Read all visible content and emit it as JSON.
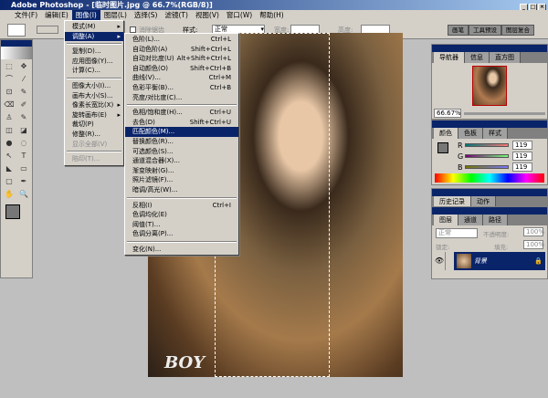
{
  "window": {
    "title": "Adobe Photoshop - [临时图片.jpg @ 66.7%(RGB/8)]"
  },
  "menubar": [
    "文件(F)",
    "编辑(E)",
    "图像(I)",
    "图层(L)",
    "选择(S)",
    "滤镜(T)",
    "视图(V)",
    "窗口(W)",
    "帮助(H)"
  ],
  "options": {
    "antialias_label": "消除锯齿",
    "style_label": "样式:",
    "style_value": "正常",
    "width_label": "宽度:",
    "height_label": "高度:"
  },
  "palette_well": [
    "画笔",
    "工具预设",
    "图层复合"
  ],
  "image_menu": [
    {
      "label": "模式(M)",
      "sub": true
    },
    {
      "label": "调整(A)",
      "sub": true,
      "hl": true
    },
    "-",
    {
      "label": "复制(D)..."
    },
    {
      "label": "应用图像(Y)..."
    },
    {
      "label": "计算(C)..."
    },
    "-",
    {
      "label": "图像大小(I)..."
    },
    {
      "label": "画布大小(S)..."
    },
    {
      "label": "像素长宽比(X)",
      "sub": true
    },
    {
      "label": "旋转画布(E)",
      "sub": true
    },
    {
      "label": "裁切(P)"
    },
    {
      "label": "修整(R)..."
    },
    {
      "label": "显示全部(V)",
      "dis": true
    },
    "-",
    {
      "label": "陷印(T)...",
      "dis": true
    }
  ],
  "adjust_menu": [
    {
      "label": "色阶(L)...",
      "sc": "Ctrl+L"
    },
    {
      "label": "自动色阶(A)",
      "sc": "Shift+Ctrl+L"
    },
    {
      "label": "自动对比度(U)",
      "sc": "Alt+Shift+Ctrl+L"
    },
    {
      "label": "自动颜色(O)",
      "sc": "Shift+Ctrl+B"
    },
    {
      "label": "曲线(V)...",
      "sc": "Ctrl+M"
    },
    {
      "label": "色彩平衡(B)...",
      "sc": "Ctrl+B"
    },
    {
      "label": "亮度/对比度(C)..."
    },
    "-",
    {
      "label": "色相/饱和度(H)...",
      "sc": "Ctrl+U"
    },
    {
      "label": "去色(D)",
      "sc": "Shift+Ctrl+U"
    },
    {
      "label": "匹配颜色(M)...",
      "hl": true
    },
    {
      "label": "替换颜色(R)..."
    },
    {
      "label": "可选颜色(S)..."
    },
    {
      "label": "通道混合器(X)..."
    },
    {
      "label": "渐变映射(G)..."
    },
    {
      "label": "照片滤镜(F)..."
    },
    {
      "label": "暗调/高光(W)..."
    },
    "-",
    {
      "label": "反相(I)",
      "sc": "Ctrl+I"
    },
    {
      "label": "色调均化(E)"
    },
    {
      "label": "阈值(T)..."
    },
    {
      "label": "色调分离(P)..."
    },
    "-",
    {
      "label": "变化(N)..."
    }
  ],
  "navigator": {
    "tabs": [
      "导航器",
      "信息",
      "直方图"
    ],
    "zoom": "66.67%"
  },
  "color": {
    "tabs": [
      "颜色",
      "色板",
      "样式"
    ],
    "r_label": "R",
    "g_label": "G",
    "b_label": "B",
    "r": "119",
    "g": "119",
    "b": "119",
    "foreground": "#777777"
  },
  "history": {
    "tabs": [
      "历史记录",
      "动作"
    ]
  },
  "layers": {
    "tabs": [
      "图层",
      "通道",
      "路径"
    ],
    "blend_mode": "正常",
    "opacity_label": "不透明度:",
    "opacity": "100%",
    "lock_label": "锁定:",
    "fill_label": "填充:",
    "fill": "100%",
    "layer_name": "背景"
  },
  "canvas": {
    "watermark": "BOY"
  }
}
